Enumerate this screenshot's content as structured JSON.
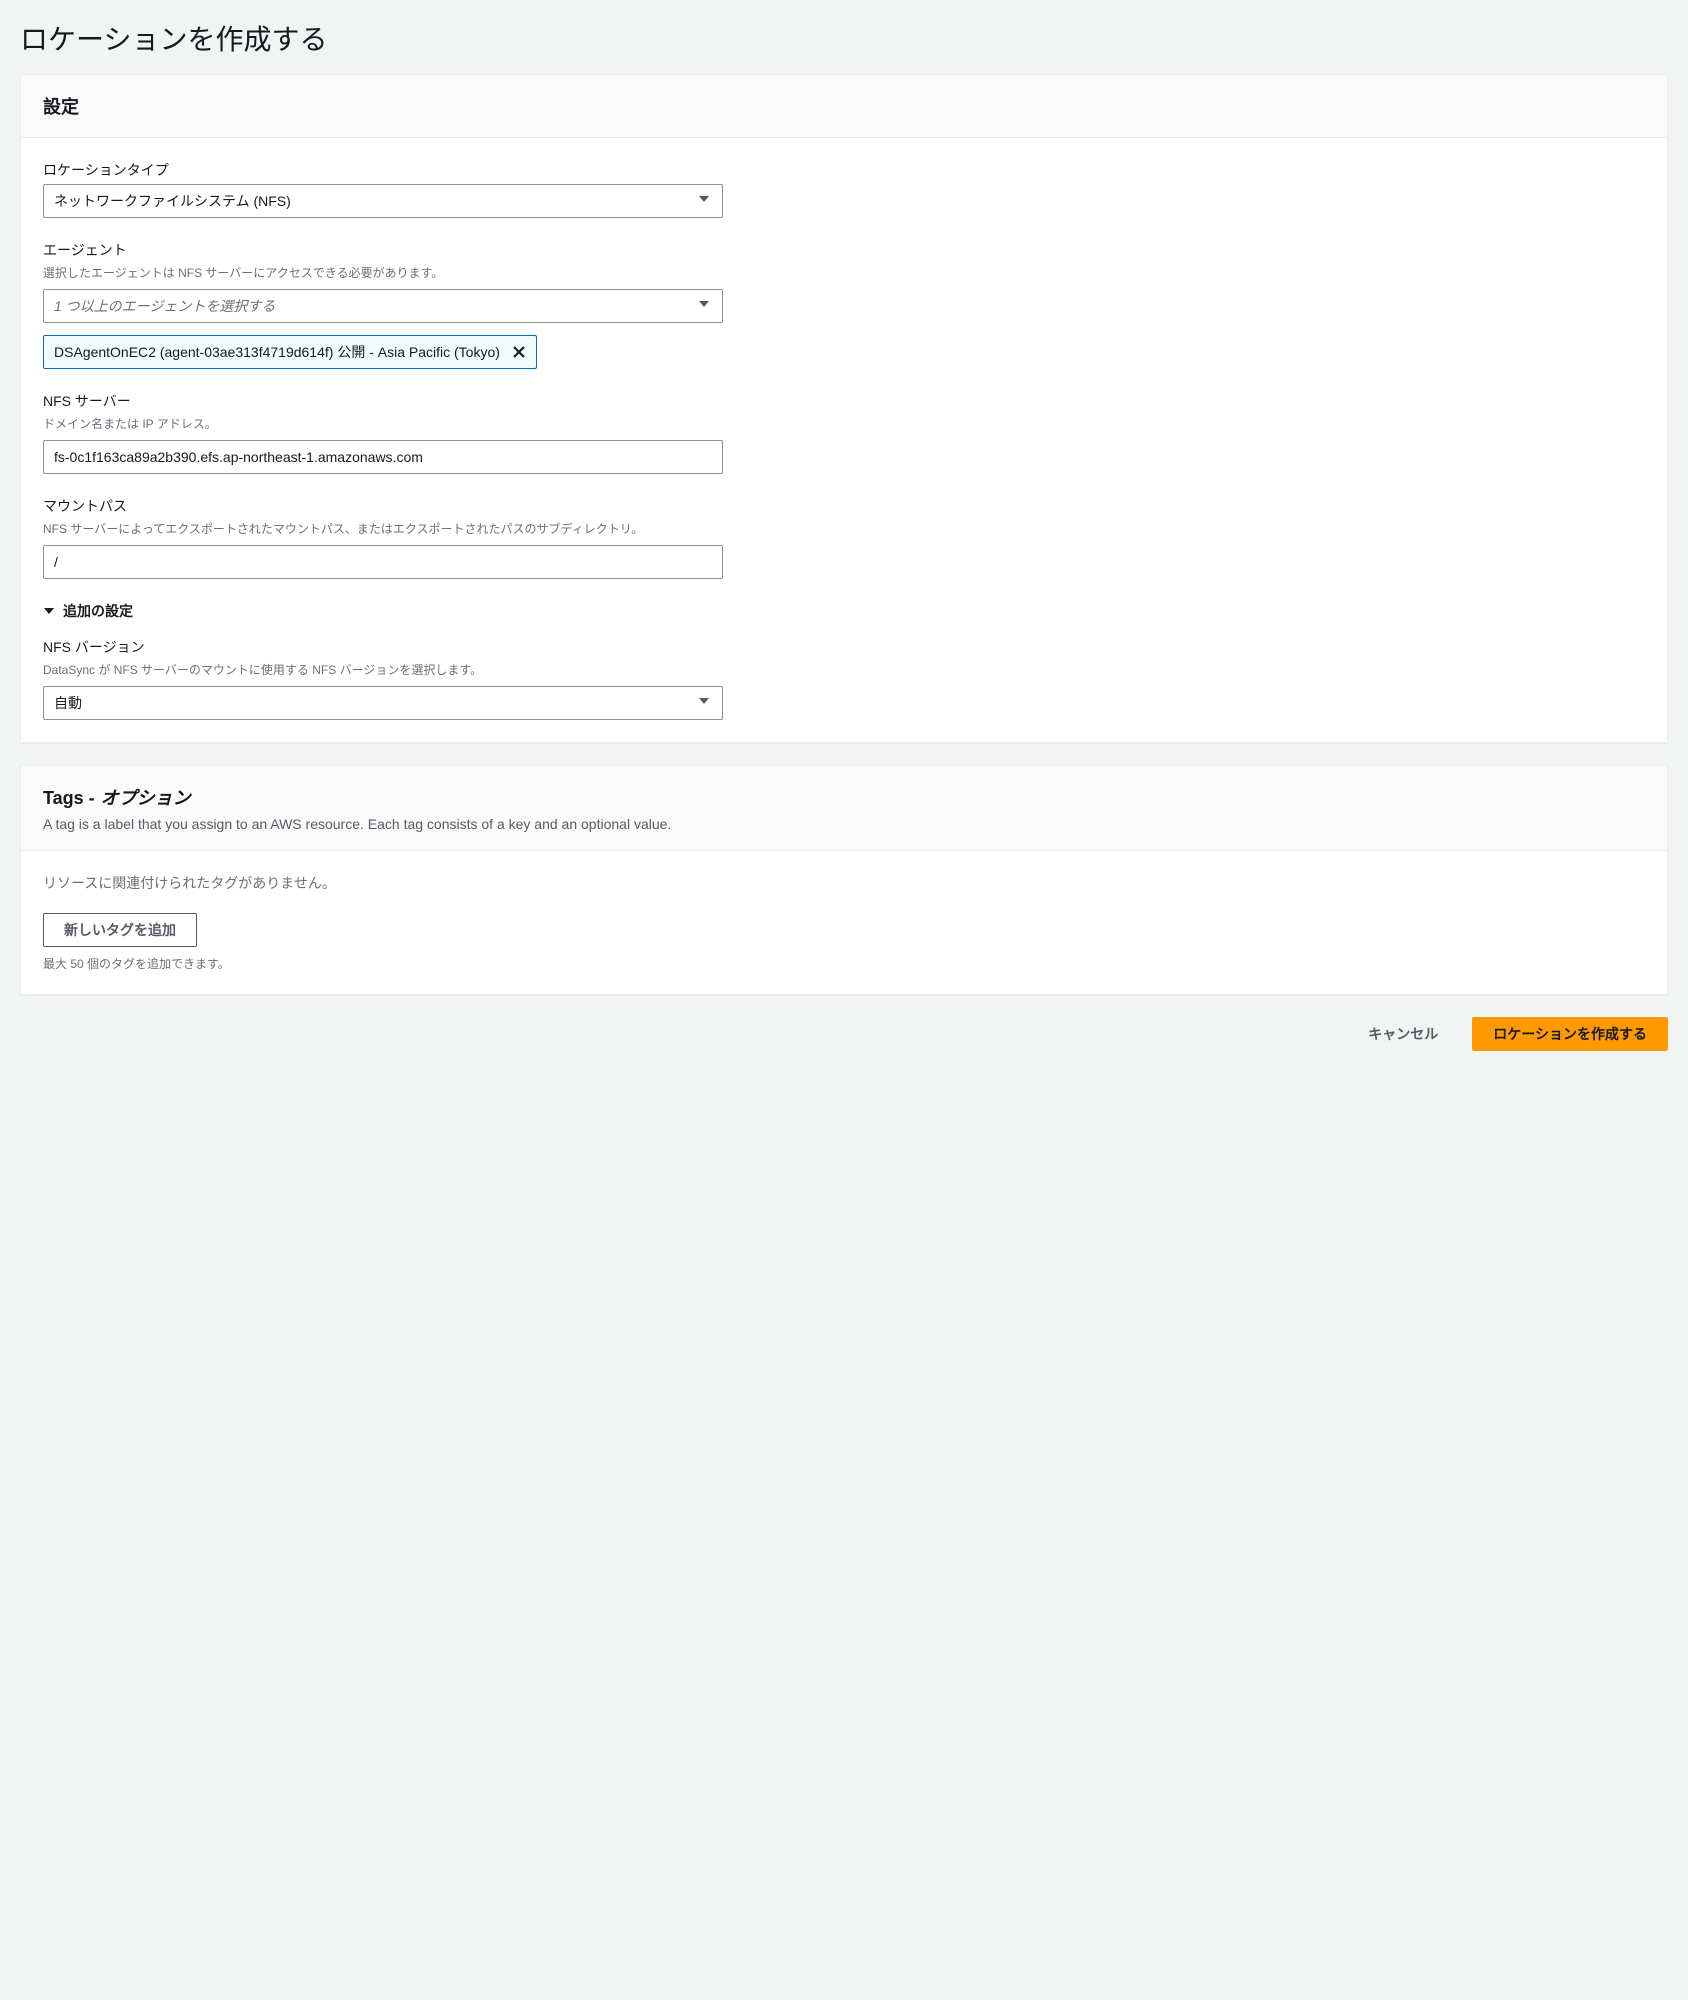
{
  "page": {
    "title": "ロケーションを作成する"
  },
  "settings_panel": {
    "header": "設定",
    "location_type": {
      "label": "ロケーションタイプ",
      "value": "ネットワークファイルシステム (NFS)"
    },
    "agent": {
      "label": "エージェント",
      "description": "選択したエージェントは NFS サーバーにアクセスできる必要があります。",
      "placeholder": "1 つ以上のエージェントを選択する",
      "selected_token": "DSAgentOnEC2 (agent-03ae313f4719d614f)   公開 - Asia Pacific (Tokyo)"
    },
    "nfs_server": {
      "label": "NFS サーバー",
      "description": "ドメイン名または IP アドレス。",
      "value": "fs-0c1f163ca89a2b390.efs.ap-northeast-1.amazonaws.com"
    },
    "mount_path": {
      "label": "マウントパス",
      "description": "NFS サーバーによってエクスポートされたマウントパス、またはエクスポートされたパスのサブディレクトリ。",
      "value": "/"
    },
    "additional_settings": {
      "label": "追加の設定"
    },
    "nfs_version": {
      "label": "NFS バージョン",
      "description": "DataSync が NFS サーバーのマウントに使用する NFS バージョンを選択します。",
      "value": "自動"
    }
  },
  "tags_panel": {
    "header_title": "Tags -",
    "header_optional": "オプション",
    "header_desc": "A tag is a label that you assign to an AWS resource. Each tag consists of a key and an optional value.",
    "no_tags_message": "リソースに関連付けられたタグがありません。",
    "add_button": "新しいタグを追加",
    "limit_hint": "最大 50 個のタグを追加できます。"
  },
  "footer": {
    "cancel": "キャンセル",
    "submit": "ロケーションを作成する"
  }
}
